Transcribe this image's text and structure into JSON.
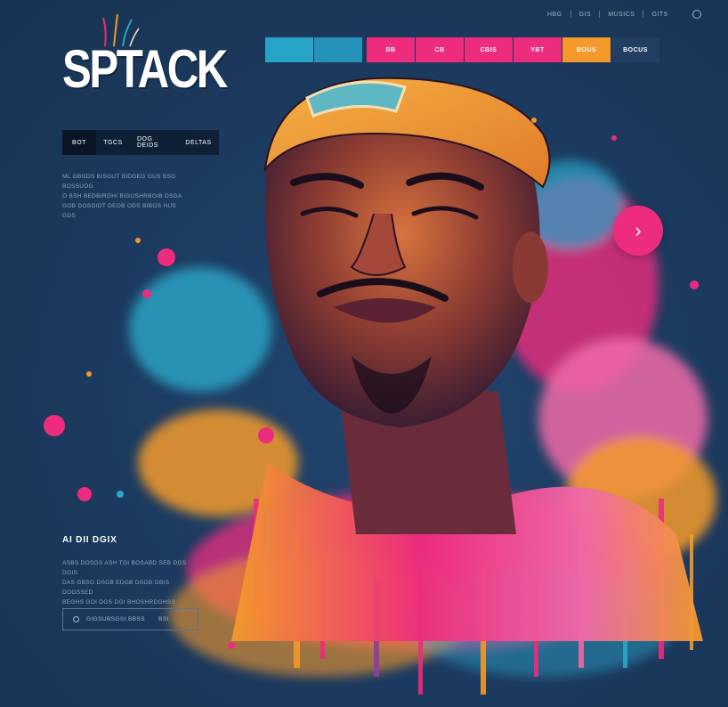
{
  "brand": {
    "logo": "SPTACK"
  },
  "top_nav": {
    "items": [
      "HBG",
      "GIS",
      "MUSICS",
      "GITS"
    ]
  },
  "tabs": [
    {
      "label": "",
      "color": "#27a3c8"
    },
    {
      "label": "",
      "color": "#27a3c8"
    },
    {
      "label": "BB",
      "color": "#ee2c7d"
    },
    {
      "label": "CB",
      "color": "#ee2c7d"
    },
    {
      "label": "CBIS",
      "color": "#ee2c7d"
    },
    {
      "label": "YBT",
      "color": "#ee2c7d"
    },
    {
      "label": "BOUS",
      "color": "#f39a2b"
    },
    {
      "label": "BOCUS",
      "color": "#223f63"
    }
  ],
  "left_buttons": [
    "BOT",
    "TGCS",
    "DOG DEIDS",
    "DELTAS"
  ],
  "intro_text": [
    "ML GBGDS BISGUT BIDGEG GUS BSG BOSSUOG",
    "O BSH BEDBIRGHI BIGUSHRBGIB DSGA",
    "GOB DOSGIDT DEOB ODS BIBGS HUS GDS"
  ],
  "section": {
    "title": "AI DII DGIX",
    "body": [
      "ASBS DOSGS ASH TGI BOSABD SEB DGS DGIS",
      "DAS GBSG DSGB EDGB DSGB GBIS DOGSSED",
      "BEGHS GOI DGS DGI BHOSHRDGHSS"
    ]
  },
  "cta": {
    "label": "GIGSUBSGSI.BBSS",
    "tag": "BSI"
  },
  "next_arrow": "›",
  "colors": {
    "background": "#1c3a5f",
    "pink": "#ee2c7d",
    "cyan": "#27a3c8",
    "orange": "#f39a2b"
  }
}
